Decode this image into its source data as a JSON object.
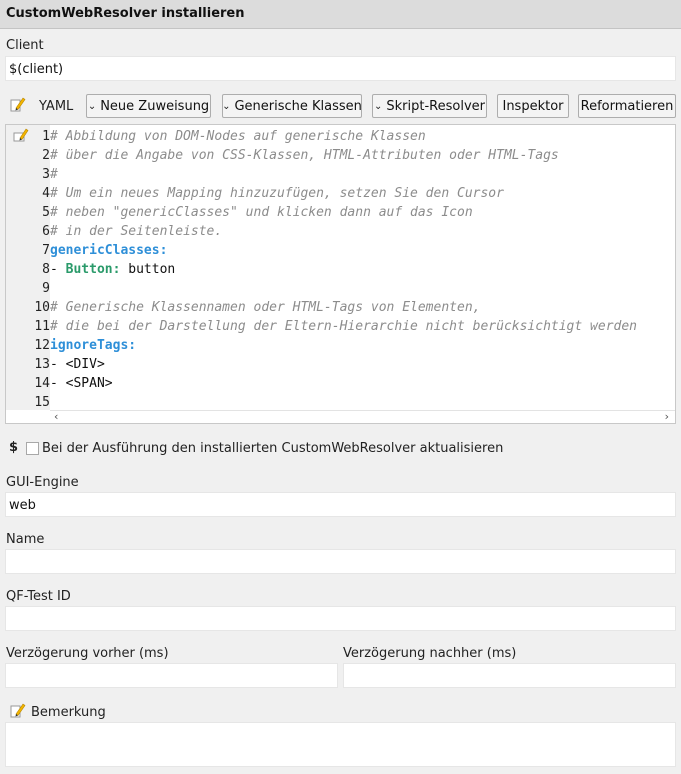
{
  "window": {
    "title": "CustomWebResolver installieren"
  },
  "client": {
    "label": "Client",
    "value": "$(client)"
  },
  "toolbar": {
    "yaml_label": "YAML",
    "buttons": [
      {
        "label": "Neue Zuweisung",
        "dropdown": true
      },
      {
        "label": "Generische Klassen",
        "dropdown": true
      },
      {
        "label": "Skript-Resolver",
        "dropdown": true
      },
      {
        "label": "Inspektor",
        "dropdown": false
      },
      {
        "label": "Reformatieren",
        "dropdown": false
      }
    ]
  },
  "editor": {
    "lines": [
      {
        "n": "1",
        "text": "# Abbildung von DOM-Nodes auf generische Klassen",
        "style": "comment"
      },
      {
        "n": "2",
        "text": "# über die Angabe von CSS-Klassen, HTML-Attributen oder HTML-Tags",
        "style": "comment"
      },
      {
        "n": "3",
        "text": "#",
        "style": "comment"
      },
      {
        "n": "4",
        "text": "# Um ein neues Mapping hinzuzufügen, setzen Sie den Cursor",
        "style": "comment"
      },
      {
        "n": "5",
        "text": "# neben \"genericClasses\" und klicken dann auf das Icon",
        "style": "comment"
      },
      {
        "n": "6",
        "text": "# in der Seitenleiste.",
        "style": "comment"
      },
      {
        "n": "7",
        "text": "genericClasses:",
        "style": "key"
      },
      {
        "n": "8",
        "dash": "- ",
        "key": "Button:",
        "rest": " button",
        "style": "item-key"
      },
      {
        "n": "9",
        "text": "",
        "style": "plain"
      },
      {
        "n": "10",
        "text": "# Generische Klassennamen oder HTML-Tags von Elementen,",
        "style": "comment"
      },
      {
        "n": "11",
        "text": "# die bei der Darstellung der Eltern-Hierarchie nicht berücksichtigt werden",
        "style": "comment"
      },
      {
        "n": "12",
        "text": "ignoreTags:",
        "style": "key"
      },
      {
        "n": "13",
        "text": "- <DIV>",
        "style": "plain"
      },
      {
        "n": "14",
        "text": "- <SPAN>",
        "style": "plain"
      },
      {
        "n": "15",
        "text": "",
        "style": "plain"
      }
    ]
  },
  "update_option": {
    "dollar": "$",
    "label": "Bei der Ausführung den installierten CustomWebResolver aktualisieren",
    "checked": false
  },
  "gui_engine": {
    "label": "GUI-Engine",
    "value": "web"
  },
  "name": {
    "label": "Name",
    "value": ""
  },
  "qftest_id": {
    "label": "QF-Test ID",
    "value": ""
  },
  "delay_before": {
    "label": "Verzögerung vorher (ms)",
    "value": ""
  },
  "delay_after": {
    "label": "Verzögerung nachher (ms)",
    "value": ""
  },
  "remark": {
    "label": "Bemerkung",
    "value": ""
  }
}
